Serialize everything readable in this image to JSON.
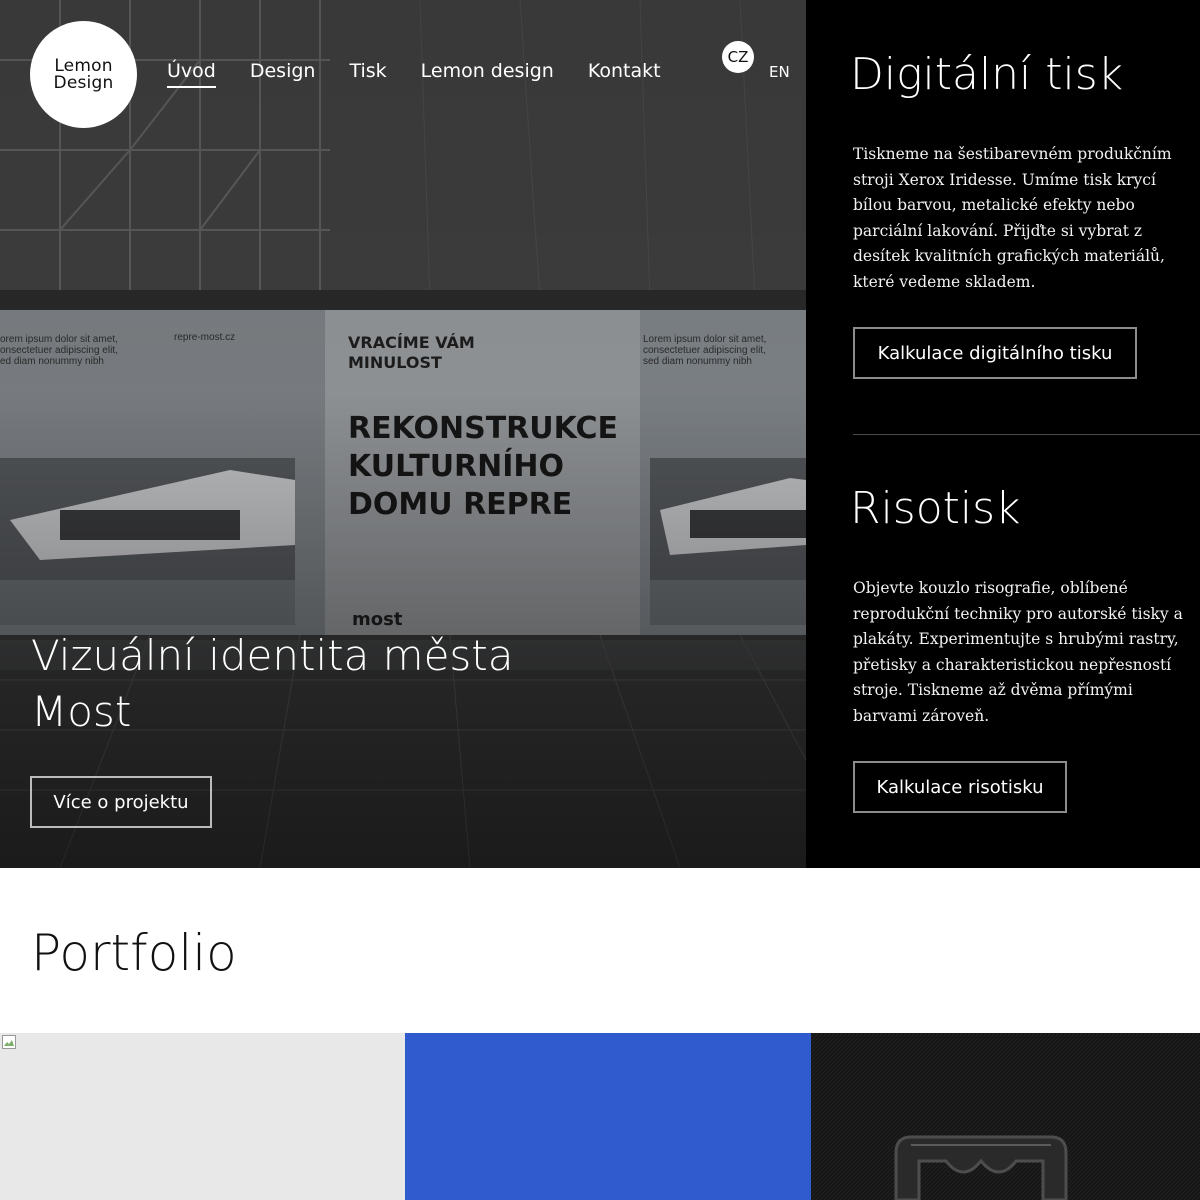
{
  "logo": {
    "line1": "Lemon",
    "line2": "Design"
  },
  "nav": {
    "items": [
      {
        "label": "Úvod",
        "active": true
      },
      {
        "label": "Design",
        "active": false
      },
      {
        "label": "Tisk",
        "active": false
      },
      {
        "label": "Lemon design",
        "active": false
      },
      {
        "label": "Kontakt",
        "active": false
      }
    ]
  },
  "lang": {
    "current": "CZ",
    "other": "EN"
  },
  "hero": {
    "title": "Vizuální identita města Most",
    "button": "Více o projektu",
    "billboard": {
      "lorem_left": "Lorem ipsum dolor sit amet,\nconsectetuer adipiscing elit,\nsed diam nonummy nibh",
      "url": "repre-most.cz",
      "tagline": "VRACÍME VÁM MINULOST",
      "headline_1": "REKONSTRUKCE",
      "headline_2": "KULTURNÍHO",
      "headline_3": "DOMU REPRE",
      "lorem_right": "Lorem ipsum dolor sit amet,\nconsectetuer adipiscing elit,\nsed diam nonummy nibh",
      "city_mark": "most"
    }
  },
  "digital": {
    "title": "Digitální tisk",
    "text": "Tiskneme na šestibarevném produkčním stroji Xerox Iridesse. Umíme tisk krycí bílou barvou, metalické efekty nebo parciální lakování. Přijďte si vybrat z desítek kvalitních grafických materiálů, které vedeme skladem.",
    "button": "Kalkulace digitálního tisku"
  },
  "riso": {
    "title": "Risotisk",
    "text": "Objevte kouzlo risografie, oblíbené reprodukční techniky pro autorské tisky a plakáty. Experimentujte s hrubými rastry, přetisky a charakteristickou nepřesností stroje. Tiskneme až dvěma přímými barvami zároveň.",
    "button": "Kalkulace risotisku"
  },
  "portfolio": {
    "title": "Portfolio"
  },
  "colors": {
    "side_bg": "#000000",
    "tile_grey": "#e8e8e8",
    "tile_blue": "#2f5bcf",
    "tile_dark": "#161616"
  }
}
